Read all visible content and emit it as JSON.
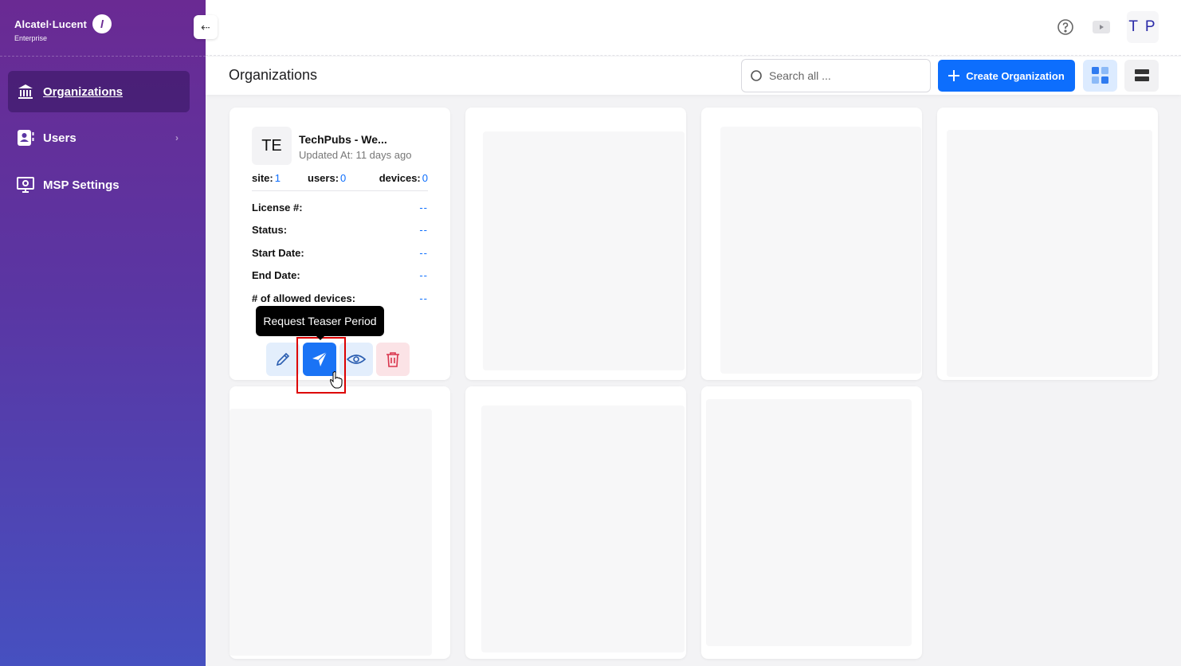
{
  "brand": {
    "name": "Alcatel·Lucent",
    "sub": "Enterprise"
  },
  "sidebar": {
    "items": [
      {
        "label": "Organizations"
      },
      {
        "label": "Users"
      },
      {
        "label": "MSP Settings"
      }
    ]
  },
  "topbar": {
    "avatar": "T P"
  },
  "header": {
    "title": "Organizations",
    "search_placeholder": "Search all ...",
    "create_label": "Create Organization"
  },
  "card": {
    "initials": "TE",
    "name": "TechPubs - We...",
    "updated": "Updated At: 11 days ago",
    "stats": {
      "site_label": "site:",
      "site_value": "1",
      "users_label": "users:",
      "users_value": "0",
      "devices_label": "devices:",
      "devices_value": "0"
    },
    "details": [
      {
        "label": "License #:",
        "value": "--"
      },
      {
        "label": "Status:",
        "value": "--"
      },
      {
        "label": "Start Date:",
        "value": "--"
      },
      {
        "label": "End Date:",
        "value": "--"
      },
      {
        "label": "# of allowed devices:",
        "value": "--"
      }
    ],
    "tooltip": "Request Teaser Period"
  },
  "colors": {
    "accent": "#0d6efd",
    "sidebar_top": "#6a2a93",
    "sidebar_bottom": "#4650c0",
    "danger": "#d9354d"
  }
}
